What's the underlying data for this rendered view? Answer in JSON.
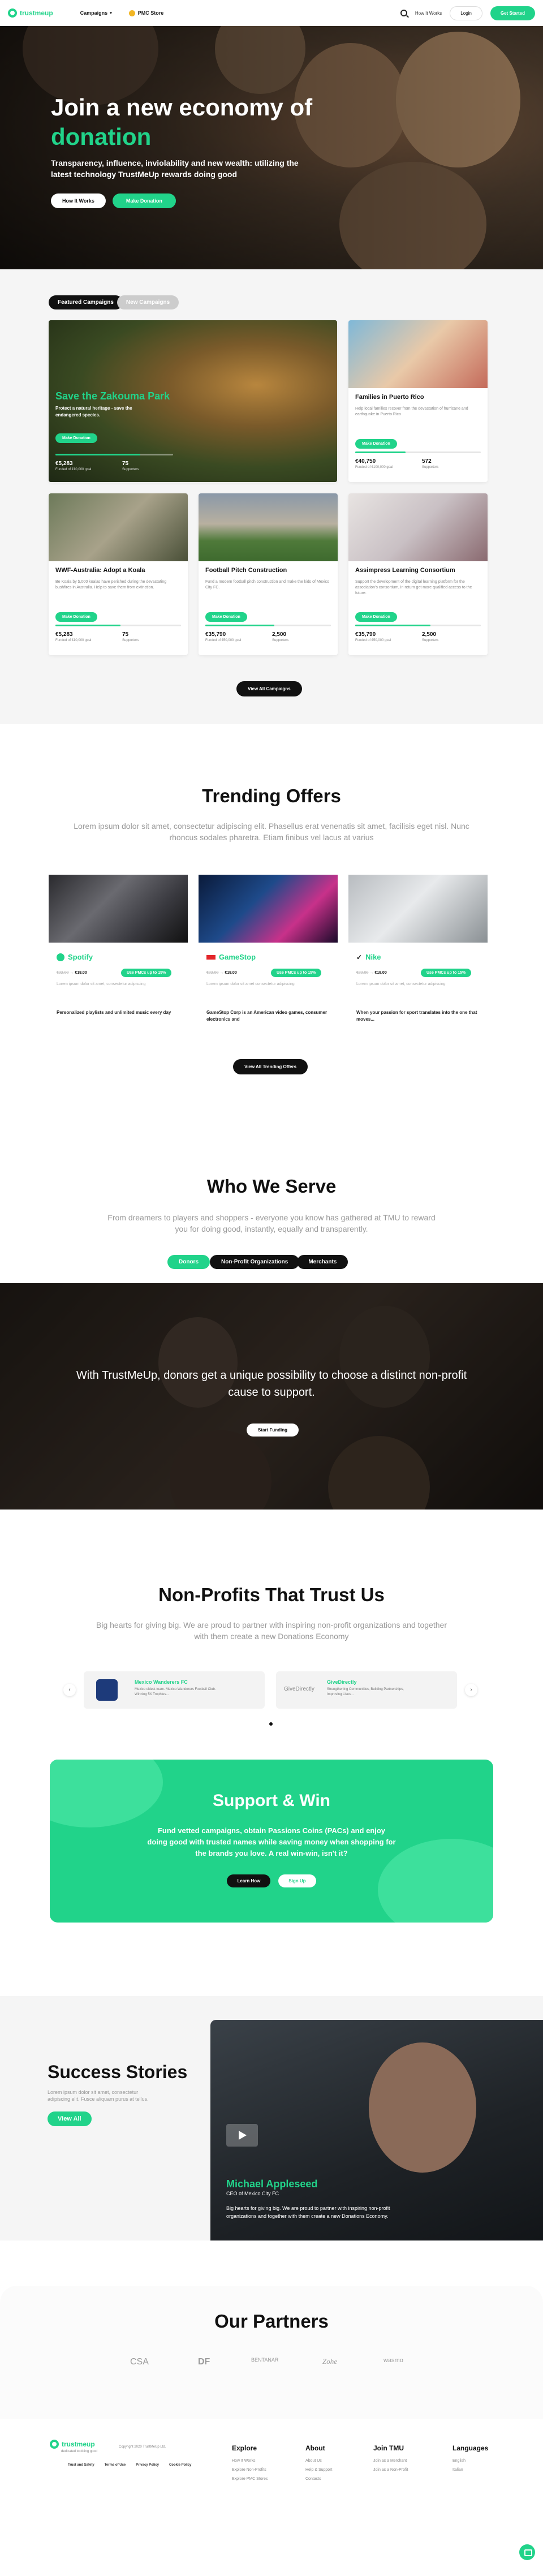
{
  "header": {
    "logo": "trustmeup",
    "campaigns": "Campaigns",
    "pmc_store": "PMC Store",
    "how_it_works": "How It Works",
    "login": "Login",
    "register": "Get Started"
  },
  "hero": {
    "title_line1": "Join a new economy of",
    "title_accent": "donation",
    "subtitle": "Transparency, influence, inviolability and new wealth: utilizing the latest technology TrustMeUp rewards doing good",
    "btn_how": "How It Works",
    "btn_donate": "Make Donation"
  },
  "campaigns": {
    "tab_featured": "Featured Campaigns",
    "tab_new": "New Campaigns",
    "featured": {
      "title": "Save the Zakouma Park",
      "desc": "Protect a natural heritage - save the endangered species.",
      "btn": "Make Donation",
      "progress": 0.72,
      "amount": "€5,283",
      "amount_label": "Funded of €10,000 goal",
      "supporters": "75",
      "supporters_label": "Supporters"
    },
    "cards": [
      {
        "title": "Families in Puerto Rico",
        "desc": "Help local families recover from the devastation of hurricane and earthquake in Puerto Rico",
        "btn": "Make Donation",
        "progress": 0.4,
        "amount": "€40,750",
        "amount_label": "Funded of €100,000 goal",
        "supporters": "572",
        "supporters_label": "Supporters"
      },
      {
        "title": "WWF-Australia: Adopt a Koala",
        "desc": "Be Koala by $,000 koalas have perished during the devastating bushfires in Australia. Help to save them from extinction.",
        "btn": "Make Donation",
        "progress": 0.52,
        "amount": "€5,283",
        "amount_label": "Funded of €10,000 goal",
        "supporters": "75",
        "supporters_label": "Supporters"
      },
      {
        "title": "Football Pitch Construction",
        "desc": "Fund a modern football pitch construction and make the kids of Mexico City FC.",
        "btn": "Make Donation",
        "progress": 0.55,
        "amount": "€35,790",
        "amount_label": "Funded of €50,000 goal",
        "supporters": "2,500",
        "supporters_label": "Supporters"
      },
      {
        "title": "Assimpress Learning Consortium",
        "desc": "Support the development of the digital learning platform for the association's consortium, in return get more qualified access to the future.",
        "btn": "Make Donation",
        "progress": 0.6,
        "amount": "€35,790",
        "amount_label": "Funded of €50,000 goal",
        "supporters": "2,500",
        "supporters_label": "Supporters"
      }
    ],
    "view_all": "View All Campaigns"
  },
  "offers": {
    "title": "Trending Offers",
    "subtitle": "Lorem ipsum dolor sit amet, consectetur adipiscing elit. Phasellus erat venenatis sit amet, facilisis eget nisl. Nunc rhoncus sodales pharetra. Etiam finibus vel lacus at varius",
    "items": [
      {
        "brand": "Spotify",
        "old_price": "€22.00",
        "price": "€18.00",
        "tag": "Use PMCs up to 15%",
        "line": "Lorem ipsum dolor sit amet, consectetur adipiscing",
        "desc": "Personalized playlists and unlimited music every day"
      },
      {
        "brand": "GameStop",
        "old_price": "€22.00",
        "price": "€18.00",
        "tag": "Use PMCs up to 15%",
        "line": "Lorem ipsum dolor sit amet consectetur adipiscing",
        "desc": "GameStop Corp is an American video games, consumer electronics and"
      },
      {
        "brand": "Nike",
        "old_price": "€22.00",
        "price": "€18.00",
        "tag": "Use PMCs up to 15%",
        "line": "Lorem ipsum dolor sit amet, consectetur adipiscing",
        "desc": "When your passion for sport translates into the one that moves..."
      }
    ],
    "view_all": "View All Trending Offers"
  },
  "serve": {
    "title": "Who We Serve",
    "subtitle": "From dreamers to players and shoppers - everyone you know has gathered at TMU to reward you for doing good, instantly, equally and transparently.",
    "tabs": [
      "Donors",
      "Non-Profit Organizations",
      "Merchants"
    ],
    "text": "With TrustMeUp, donors get a unique possibility to choose a distinct non-profit cause to support.",
    "btn": "Start Funding"
  },
  "nonprofits": {
    "title": "Non-Profits That Trust Us",
    "subtitle": "Big hearts for giving big. We are proud to partner with inspiring non-profit organizations and together with them create a new Donations Economy",
    "items": [
      {
        "logo": "Mexico City FC",
        "name": "Mexico Wanderers FC",
        "desc": "Mexico oldest team. Mexico Wanderers Football Club. Winning 5X Trophies..."
      },
      {
        "logo": "GiveDirectly",
        "name": "GiveDirectly",
        "desc": "Strengthening Communities, Building Partnerships, Improving Lives..."
      }
    ]
  },
  "support": {
    "title": "Support & Win",
    "text": "Fund vetted campaigns, obtain Passions Coins (PACs) and enjoy doing good with trusted names while saving money when shopping for the brands you love. A real win-win, isn't it?",
    "btn_learn": "Learn How",
    "btn_signup": "Sign Up"
  },
  "success": {
    "title": "Success Stories",
    "subtitle": "Lorem ipsum dolor sit amet, consectetur adipiscing elit. Fusce aliquam purus at tellus.",
    "btn": "View All",
    "name": "Michael Appleseed",
    "role": "CEO of Mexico City FC",
    "text": "Big hearts for giving big. We are proud to partner with inspiring non-profit organizations and together with them create a new Donations Economy."
  },
  "partners": {
    "title": "Our Partners",
    "logos": [
      "CSA",
      "DF",
      "BENTANAR",
      "Zohe",
      "wasmo"
    ]
  },
  "footer": {
    "logo": "trustmeup",
    "tagline": "dedicated to doing good",
    "copyright": "Copyright 2020 TrustMeUp Ltd.",
    "bottom_links": [
      "Trust and Safety",
      "Terms of Use",
      "Privacy Policy",
      "Cookie Policy"
    ],
    "columns": [
      {
        "title": "Explore",
        "links": [
          "How It Works",
          "Explore Non-Profits",
          "Explore PMC Stores"
        ]
      },
      {
        "title": "About",
        "links": [
          "About Us",
          "Help & Support",
          "Contacts"
        ]
      },
      {
        "title": "Join TMU",
        "links": [
          "Join as a Merchant",
          "Join as a Non-Profit"
        ]
      },
      {
        "title": "Languages",
        "links": [
          "English",
          "Italian"
        ]
      }
    ]
  },
  "colors": {
    "accent": "#21d38a",
    "dark": "#111111"
  }
}
